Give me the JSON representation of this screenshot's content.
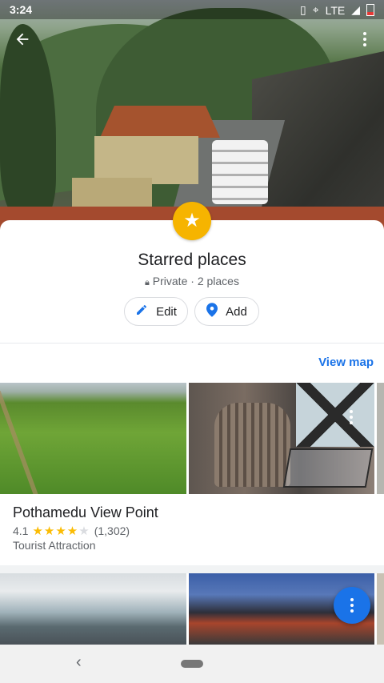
{
  "status_bar": {
    "time": "3:24",
    "network": "LTE",
    "icons": [
      "vibrate-icon",
      "location-icon",
      "signal-icon",
      "battery-icon"
    ]
  },
  "hero": {
    "back_icon": "arrow-back-icon",
    "more_icon": "more-vert-icon"
  },
  "list": {
    "badge_icon": "star-icon",
    "badge_color": "#f6b400",
    "title": "Starred places",
    "privacy": "Private",
    "separator": "·",
    "count": "2 places",
    "lock_icon": "lock-icon"
  },
  "actions": {
    "edit_label": "Edit",
    "edit_icon": "pencil-icon",
    "add_label": "Add",
    "add_icon": "location-pin-icon",
    "accent": "#1a73e8"
  },
  "view_map_label": "View map",
  "places": [
    {
      "name": "Pothamedu View Point",
      "rating": "4.1",
      "stars_filled": 4,
      "reviews": "(1,302)",
      "category": "Tourist Attraction"
    }
  ],
  "fab_icon": "more-vert-icon",
  "nav": {
    "back_icon": "chevron-left-icon",
    "home_icon": "home-pill-icon",
    "back_glyph": "‹"
  }
}
